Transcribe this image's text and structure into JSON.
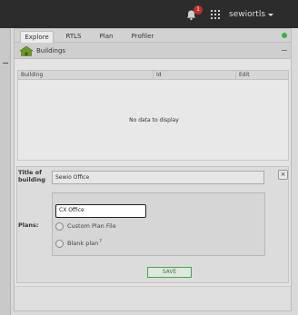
{
  "topbar": {
    "notification_count": "1",
    "username": "sewiortls",
    "icons": [
      "bell-icon",
      "apps-grid-icon",
      "caret-down-icon"
    ]
  },
  "tabs": [
    {
      "label": "Explore",
      "active": true
    },
    {
      "label": "RTLS",
      "active": false
    },
    {
      "label": "Plan",
      "active": false
    },
    {
      "label": "Profiler",
      "active": false
    }
  ],
  "status_color": "#3cb043",
  "section": {
    "title": "Buildings",
    "icon": "building-icon"
  },
  "table": {
    "columns": [
      "Building",
      "Id",
      "Edit"
    ],
    "empty_message": "No data to display"
  },
  "form": {
    "title_label": "Title of building",
    "title_value": "Sewio Office",
    "close_label": "×",
    "plans_label": "Plans:",
    "plan_name_value": "CX Office",
    "options": [
      {
        "label": "Custom Plan File",
        "selected": false
      },
      {
        "label": "Blank plan",
        "help_mark": "?",
        "selected": false
      }
    ],
    "save_label": "SAVE"
  }
}
